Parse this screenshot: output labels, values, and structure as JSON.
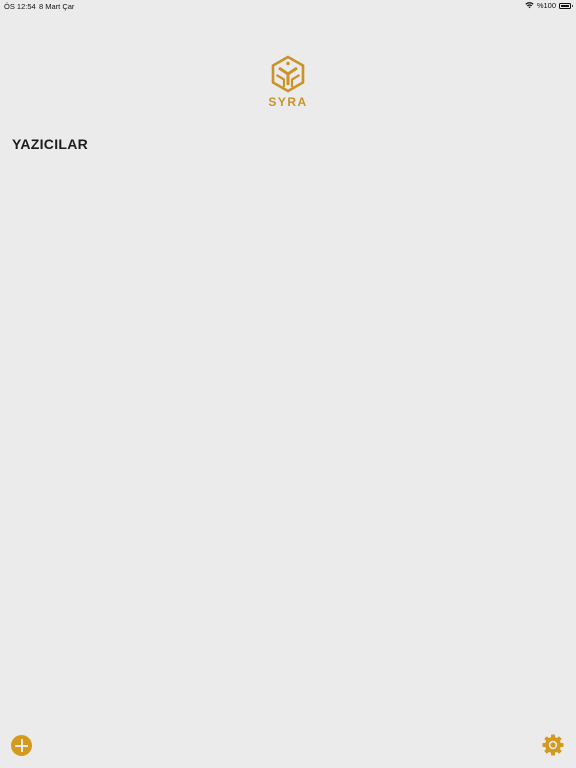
{
  "status_bar": {
    "time": "ÖS 12:54",
    "date": "8 Mart Çar",
    "battery_text": "%100",
    "wifi_icon": "wifi-icon",
    "battery_icon": "battery-icon"
  },
  "logo": {
    "text": "SYRA",
    "icon": "syra-logo-icon"
  },
  "main": {
    "section_title": "YAZICILAR"
  },
  "toolbar": {
    "add_icon": "plus-circle-icon",
    "settings_icon": "gear-icon"
  },
  "colors": {
    "accent": "#d39a1c",
    "background": "#ebebeb",
    "text": "#1d1d1d"
  }
}
